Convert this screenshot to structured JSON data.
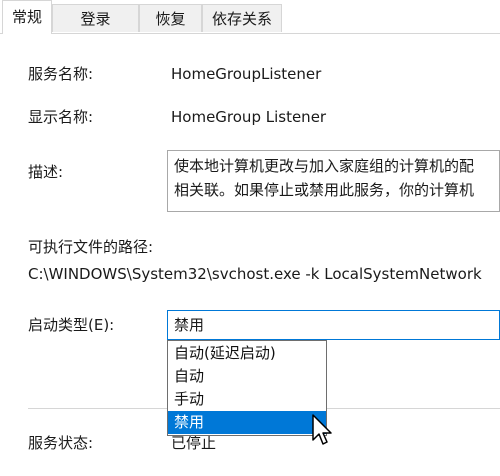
{
  "tabs": [
    {
      "label": "常规",
      "active": true
    },
    {
      "label": "登录",
      "active": false
    },
    {
      "label": "恢复",
      "active": false
    },
    {
      "label": "依存关系",
      "active": false
    }
  ],
  "fields": {
    "service_name_label": "服务名称:",
    "service_name_value": "HomeGroupListener",
    "display_name_label": "显示名称:",
    "display_name_value": "HomeGroup Listener",
    "description_label": "描述:",
    "description_line1": "使本地计算机更改与加入家庭组的计算机的配",
    "description_line2": "相关联。如果停止或禁用此服务，你的计算机",
    "exec_path_label": "可执行文件的路径:",
    "exec_path_value": "C:\\WINDOWS\\System32\\svchost.exe -k LocalSystemNetwork",
    "startup_type_label": "启动类型(E):",
    "startup_type_value": "禁用",
    "service_status_label": "服务状态:",
    "service_status_value": "已停止"
  },
  "startup_options": [
    {
      "label": "自动(延迟启动)",
      "selected": false
    },
    {
      "label": "自动",
      "selected": false
    },
    {
      "label": "手动",
      "selected": false
    },
    {
      "label": "禁用",
      "selected": true
    }
  ],
  "colors": {
    "accent": "#0078d7",
    "border": "#a8a8a8",
    "tab_inactive_bg": "#f0f0f0"
  },
  "icons": {
    "cursor": "mouse-pointer-icon"
  }
}
